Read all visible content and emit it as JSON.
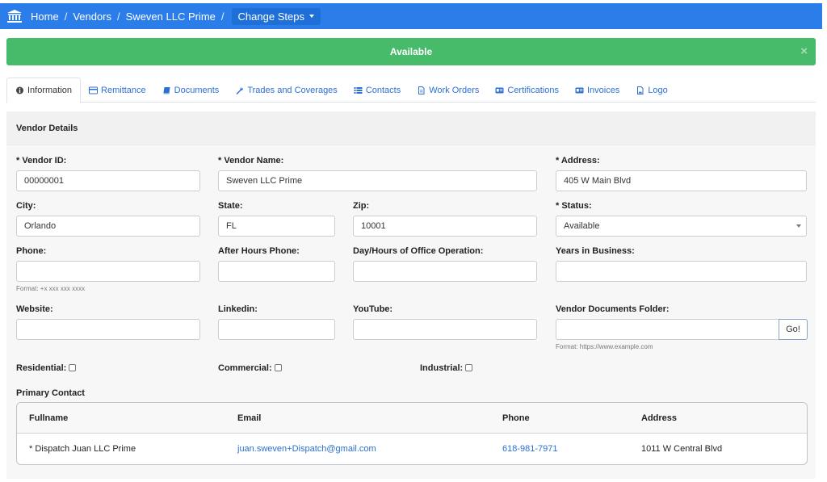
{
  "breadcrumb": {
    "home": "Home",
    "vendors": "Vendors",
    "vendor": "Sweven LLC Prime",
    "sep": "/",
    "dropdown_label": "Change Steps"
  },
  "alert": {
    "text": "Available",
    "close": "×"
  },
  "tabs": [
    {
      "label": "Information",
      "icon": "info-circle-icon"
    },
    {
      "label": "Remittance",
      "icon": "credit-card-icon"
    },
    {
      "label": "Documents",
      "icon": "book-icon"
    },
    {
      "label": "Trades and Coverages",
      "icon": "wrench-icon"
    },
    {
      "label": "Contacts",
      "icon": "list-icon"
    },
    {
      "label": "Work Orders",
      "icon": "file-icon"
    },
    {
      "label": "Certifications",
      "icon": "id-card-icon"
    },
    {
      "label": "Invoices",
      "icon": "id-card-icon"
    },
    {
      "label": "Logo",
      "icon": "image-file-icon"
    }
  ],
  "card": {
    "title": "Vendor Details"
  },
  "fields": {
    "vendor_id": {
      "label": "* Vendor ID:",
      "value": "00000001"
    },
    "vendor_name": {
      "label": "* Vendor Name:",
      "value": "Sweven LLC Prime"
    },
    "address": {
      "label": "* Address:",
      "value": "405 W Main Blvd"
    },
    "city": {
      "label": "City:",
      "value": "Orlando"
    },
    "state": {
      "label": "State:",
      "value": "FL"
    },
    "zip": {
      "label": "Zip:",
      "value": "10001"
    },
    "status": {
      "label": "* Status:",
      "value": "Available"
    },
    "phone": {
      "label": "Phone:",
      "value": "",
      "hint": "Format: +x xxx xxx xxxx"
    },
    "after_hours_phone": {
      "label": "After Hours Phone:",
      "value": ""
    },
    "office_hours": {
      "label": "Day/Hours of Office Operation:",
      "value": ""
    },
    "years_in_business": {
      "label": "Years in Business:",
      "value": ""
    },
    "website": {
      "label": "Website:",
      "value": ""
    },
    "linkedin": {
      "label": "Linkedin:",
      "value": ""
    },
    "youtube": {
      "label": "YouTube:",
      "value": ""
    },
    "docs_folder": {
      "label": "Vendor Documents Folder:",
      "value": "",
      "hint": "Format: https://www.example.com",
      "button": "Go!"
    }
  },
  "checkboxes": {
    "residential": "Residential:",
    "commercial": "Commercial:",
    "industrial": "Industrial:"
  },
  "primary_contact": {
    "title": "Primary Contact",
    "columns": [
      "Fullname",
      "Email",
      "Phone",
      "Address"
    ],
    "row": {
      "fullname": "* Dispatch Juan LLC Prime",
      "email": "juan.sweven+Dispatch@gmail.com",
      "phone": "618-981-7971",
      "address": "1011 W Central Blvd"
    }
  }
}
